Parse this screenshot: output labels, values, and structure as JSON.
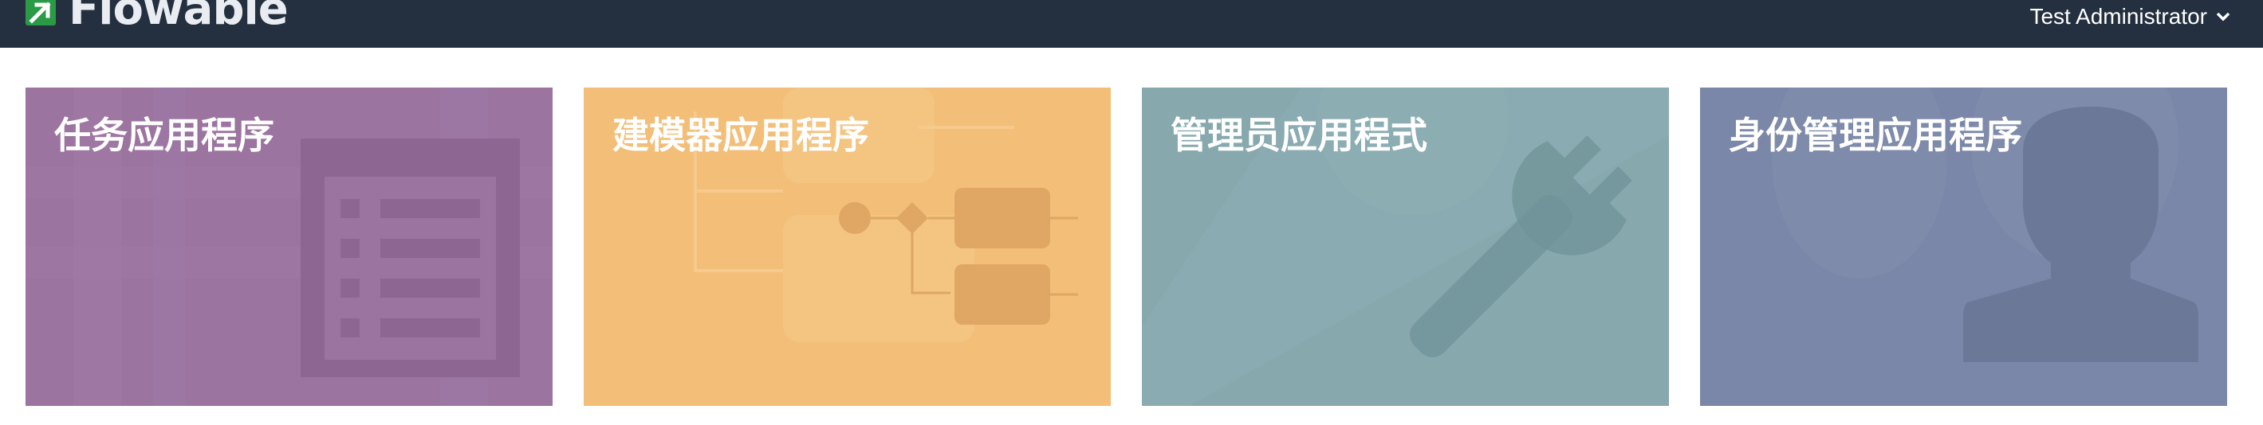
{
  "header": {
    "logo_text": "Flowable",
    "user_name": "Test Administrator"
  },
  "apps": [
    {
      "title": "任务应用程序",
      "color": "#9b74a0",
      "icon": "task-list-icon"
    },
    {
      "title": "建模器应用程序",
      "color": "#f2be78",
      "icon": "process-diagram-icon"
    },
    {
      "title": "管理员应用程式",
      "color": "#87a9ae",
      "icon": "wrench-icon"
    },
    {
      "title": "身份管理应用程序",
      "color": "#7b87a8",
      "icon": "user-silhouette-icon"
    }
  ]
}
